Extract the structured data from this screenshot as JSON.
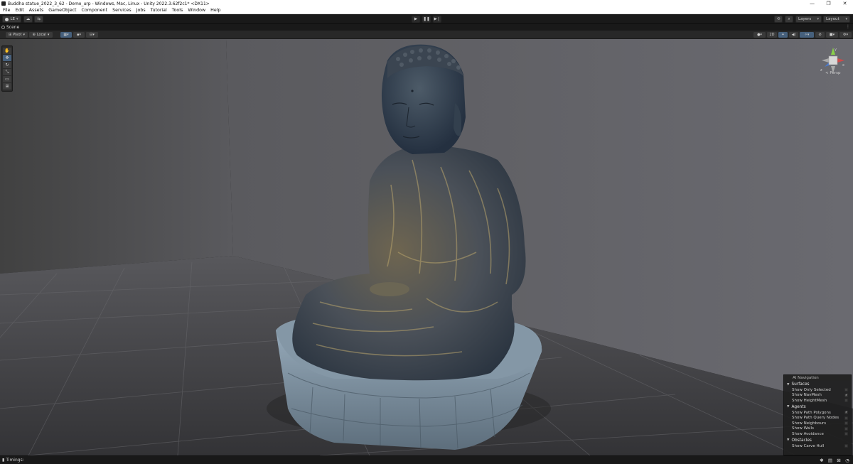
{
  "window": {
    "title": "Buddha statue_2022_3_62 - Demo_urp - Windows, Mac, Linux - Unity 2022.3.62f2c1* <DX11>",
    "controls": {
      "minimize": "—",
      "maximize": "❐",
      "close": "✕"
    }
  },
  "menu": {
    "items": [
      "File",
      "Edit",
      "Assets",
      "GameObject",
      "Component",
      "Services",
      "Jobs",
      "Tutorial",
      "Tools",
      "Window",
      "Help"
    ]
  },
  "toolbar": {
    "account": "LE",
    "cloud_icon": "cloud-icon",
    "collab_icon": "collab-icon",
    "play_icon": "play-icon",
    "pause_icon": "pause-icon",
    "step_icon": "step-icon",
    "history_icon": "history-icon",
    "search_icon": "search-icon",
    "layers": "Layers",
    "layout": "Layout"
  },
  "scene": {
    "tab_label": "Scene",
    "pivot": "Pivot",
    "local": "Local",
    "twod": "2D",
    "persp_label": "< Persp",
    "gizmo_axes": {
      "y": "y",
      "x": "x",
      "z": "z"
    },
    "accent_color": "#46607c"
  },
  "tools": [
    "hand-tool-icon",
    "move-tool-icon",
    "rotate-tool-icon",
    "scale-tool-icon",
    "rect-tool-icon",
    "transform-tool-icon"
  ],
  "ai_navigation": {
    "title": "AI Navigation",
    "sections": [
      {
        "name": "Surfaces",
        "rows": [
          {
            "label": "Show Only Selected",
            "checked": false
          },
          {
            "label": "Show NavMesh",
            "checked": true
          },
          {
            "label": "Show HeightMesh",
            "checked": false
          }
        ]
      },
      {
        "name": "Agents",
        "rows": [
          {
            "label": "Show Path Polygons",
            "checked": true
          },
          {
            "label": "Show Path Query Nodes",
            "checked": false
          },
          {
            "label": "Show Neighbours",
            "checked": false
          },
          {
            "label": "Show Walls",
            "checked": false
          },
          {
            "label": "Show Avoidance",
            "checked": false
          }
        ]
      },
      {
        "name": "Obstacles",
        "rows": [
          {
            "label": "Show Carve Hull",
            "checked": false
          }
        ]
      }
    ]
  },
  "status": {
    "timings": "Timings:"
  }
}
